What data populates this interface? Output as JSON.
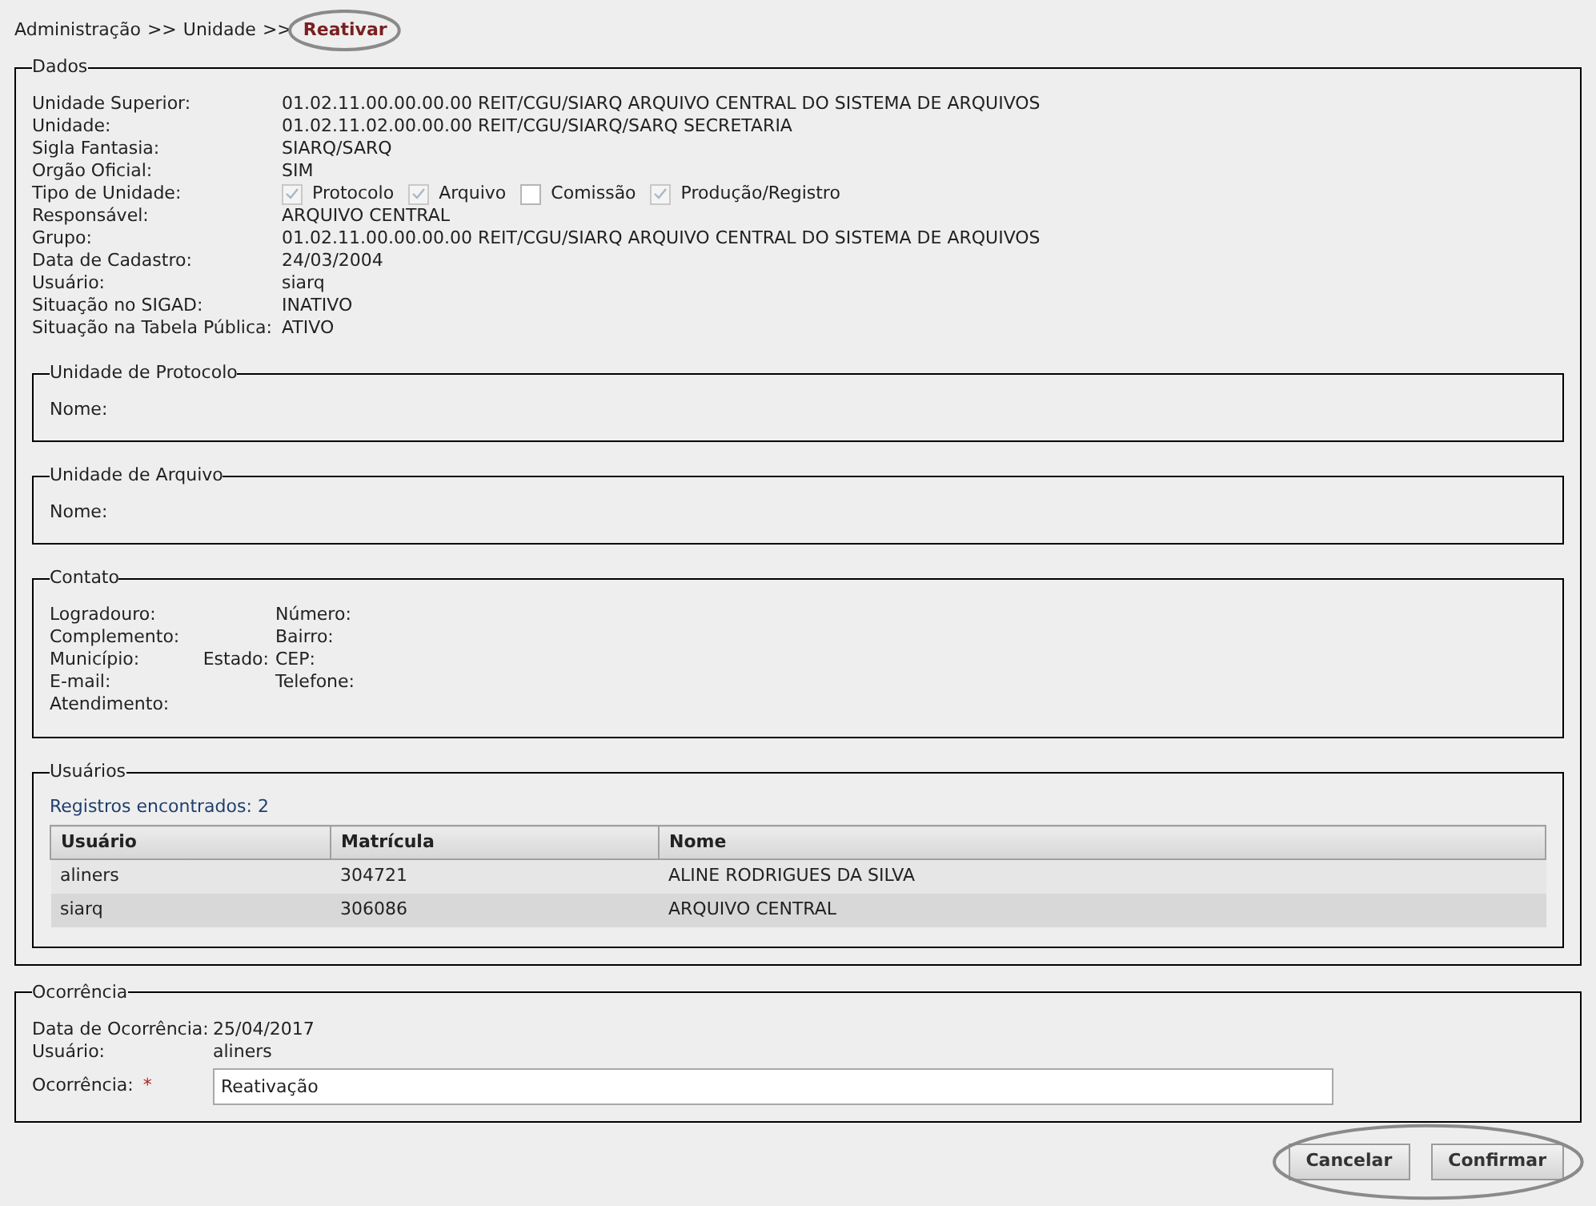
{
  "breadcrumb": [
    {
      "text": "Administração",
      "kind": "link",
      "circled": false
    },
    {
      "text": ">>",
      "kind": "separator",
      "circled": false
    },
    {
      "text": "Unidade",
      "kind": "link",
      "circled": false
    },
    {
      "text": ">>",
      "kind": "separator",
      "circled": false
    },
    {
      "text": "Reativar",
      "kind": "current",
      "circled": true
    }
  ],
  "dados": {
    "legend": "Dados",
    "fields": [
      {
        "kind": "text",
        "label": "Unidade Superior:",
        "value": "01.02.11.00.00.00.00 REIT/CGU/SIARQ ARQUIVO CENTRAL DO SISTEMA DE ARQUIVOS"
      },
      {
        "kind": "text",
        "label": "Unidade:",
        "value": "01.02.11.02.00.00.00 REIT/CGU/SIARQ/SARQ SECRETARIA"
      },
      {
        "kind": "text",
        "label": "Sigla Fantasia:",
        "value": "SIARQ/SARQ"
      },
      {
        "kind": "text",
        "label": "Orgão Oficial:",
        "value": "SIM"
      },
      {
        "kind": "checkboxes",
        "label": "Tipo de Unidade:",
        "options": [
          {
            "label": "Protocolo",
            "checked": true
          },
          {
            "label": "Arquivo",
            "checked": true
          },
          {
            "label": "Comissão",
            "checked": false
          },
          {
            "label": "Produção/Registro",
            "checked": true
          }
        ]
      },
      {
        "kind": "text",
        "label": "Responsável:",
        "value": "ARQUIVO CENTRAL"
      },
      {
        "kind": "text",
        "label": "Grupo:",
        "value": "01.02.11.00.00.00.00 REIT/CGU/SIARQ ARQUIVO CENTRAL DO SISTEMA DE ARQUIVOS"
      },
      {
        "kind": "text",
        "label": "Data de Cadastro:",
        "value": "24/03/2004"
      },
      {
        "kind": "text",
        "label": "Usuário:",
        "value": "siarq"
      },
      {
        "kind": "text",
        "label": "Situação no SIGAD:",
        "value": "INATIVO"
      },
      {
        "kind": "text",
        "label": "Situação na Tabela Pública:",
        "value": "ATIVO"
      }
    ],
    "unidade_protocolo": {
      "legend": "Unidade de Protocolo",
      "label": "Nome:"
    },
    "unidade_arquivo": {
      "legend": "Unidade de Arquivo",
      "label": "Nome:"
    },
    "contato": {
      "legend": "Contato",
      "rows": [
        [
          "Logradouro:",
          "",
          "Número:"
        ],
        [
          "Complemento:",
          "",
          "Bairro:"
        ],
        [
          "Município:",
          "Estado:",
          "CEP:"
        ],
        [
          "E-mail:",
          "",
          "Telefone:"
        ],
        [
          "Atendimento:",
          "",
          ""
        ]
      ]
    },
    "usuarios": {
      "legend": "Usuários",
      "count": "Registros encontrados: 2",
      "columns": [
        "Usuário",
        "Matrícula",
        "Nome"
      ],
      "rows": [
        [
          "aliners",
          "304721",
          "ALINE RODRIGUES DA SILVA"
        ],
        [
          "siarq",
          "306086",
          "ARQUIVO CENTRAL"
        ]
      ]
    }
  },
  "ocorrencia": {
    "legend": "Ocorrência",
    "fields": [
      {
        "label": "Data de Ocorrência:",
        "value": "25/04/2017"
      },
      {
        "label": "Usuário:",
        "value": "aliners"
      }
    ],
    "input": {
      "label": "Ocorrência:",
      "required": true,
      "required_mark": "*",
      "value": "Reativação"
    }
  },
  "actions": {
    "circled": true,
    "buttons": [
      "Cancelar",
      "Confirmar"
    ]
  }
}
